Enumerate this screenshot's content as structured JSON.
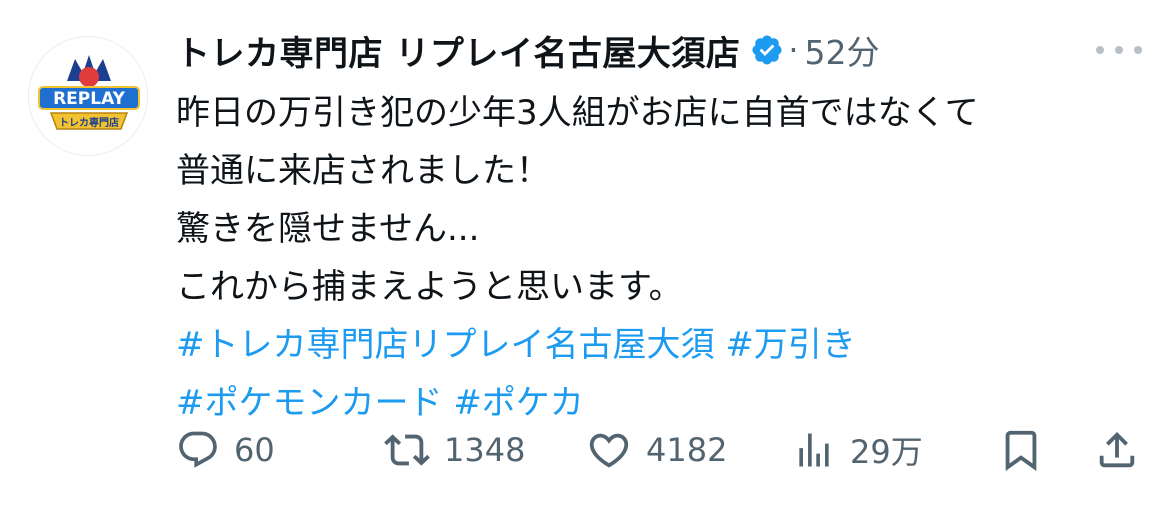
{
  "tweet": {
    "author": {
      "display_name": "トレカ専門店 リプレイ名古屋大須店",
      "avatar_label": "REPLAY",
      "avatar_sublabel": "トレカ専門店",
      "verified": true
    },
    "separator": "·",
    "timestamp": "52分",
    "text_lines": [
      "昨日の万引き犯の少年3人組がお店に自首ではなくて",
      "普通に来店されました！",
      "驚きを隠せません...",
      "これから捕まえようと思います。"
    ],
    "hashtags_line1": [
      "#トレカ専門店リプレイ名古屋大須",
      "#万引き"
    ],
    "hashtags_line2": [
      "#ポケモンカード",
      "#ポケカ"
    ]
  },
  "actions": {
    "replies": "60",
    "retweets": "1348",
    "likes": "4182",
    "views": "29万"
  },
  "colors": {
    "text": "#0f1419",
    "muted": "#536471",
    "link": "#1d9bf0",
    "verified": "#1d9bf0"
  },
  "icons": {
    "reply": "reply-icon",
    "retweet": "retweet-icon",
    "like": "heart-icon",
    "views": "views-icon",
    "bookmark": "bookmark-icon",
    "share": "share-icon",
    "more": "more-icon",
    "verified": "verified-badge-icon"
  }
}
